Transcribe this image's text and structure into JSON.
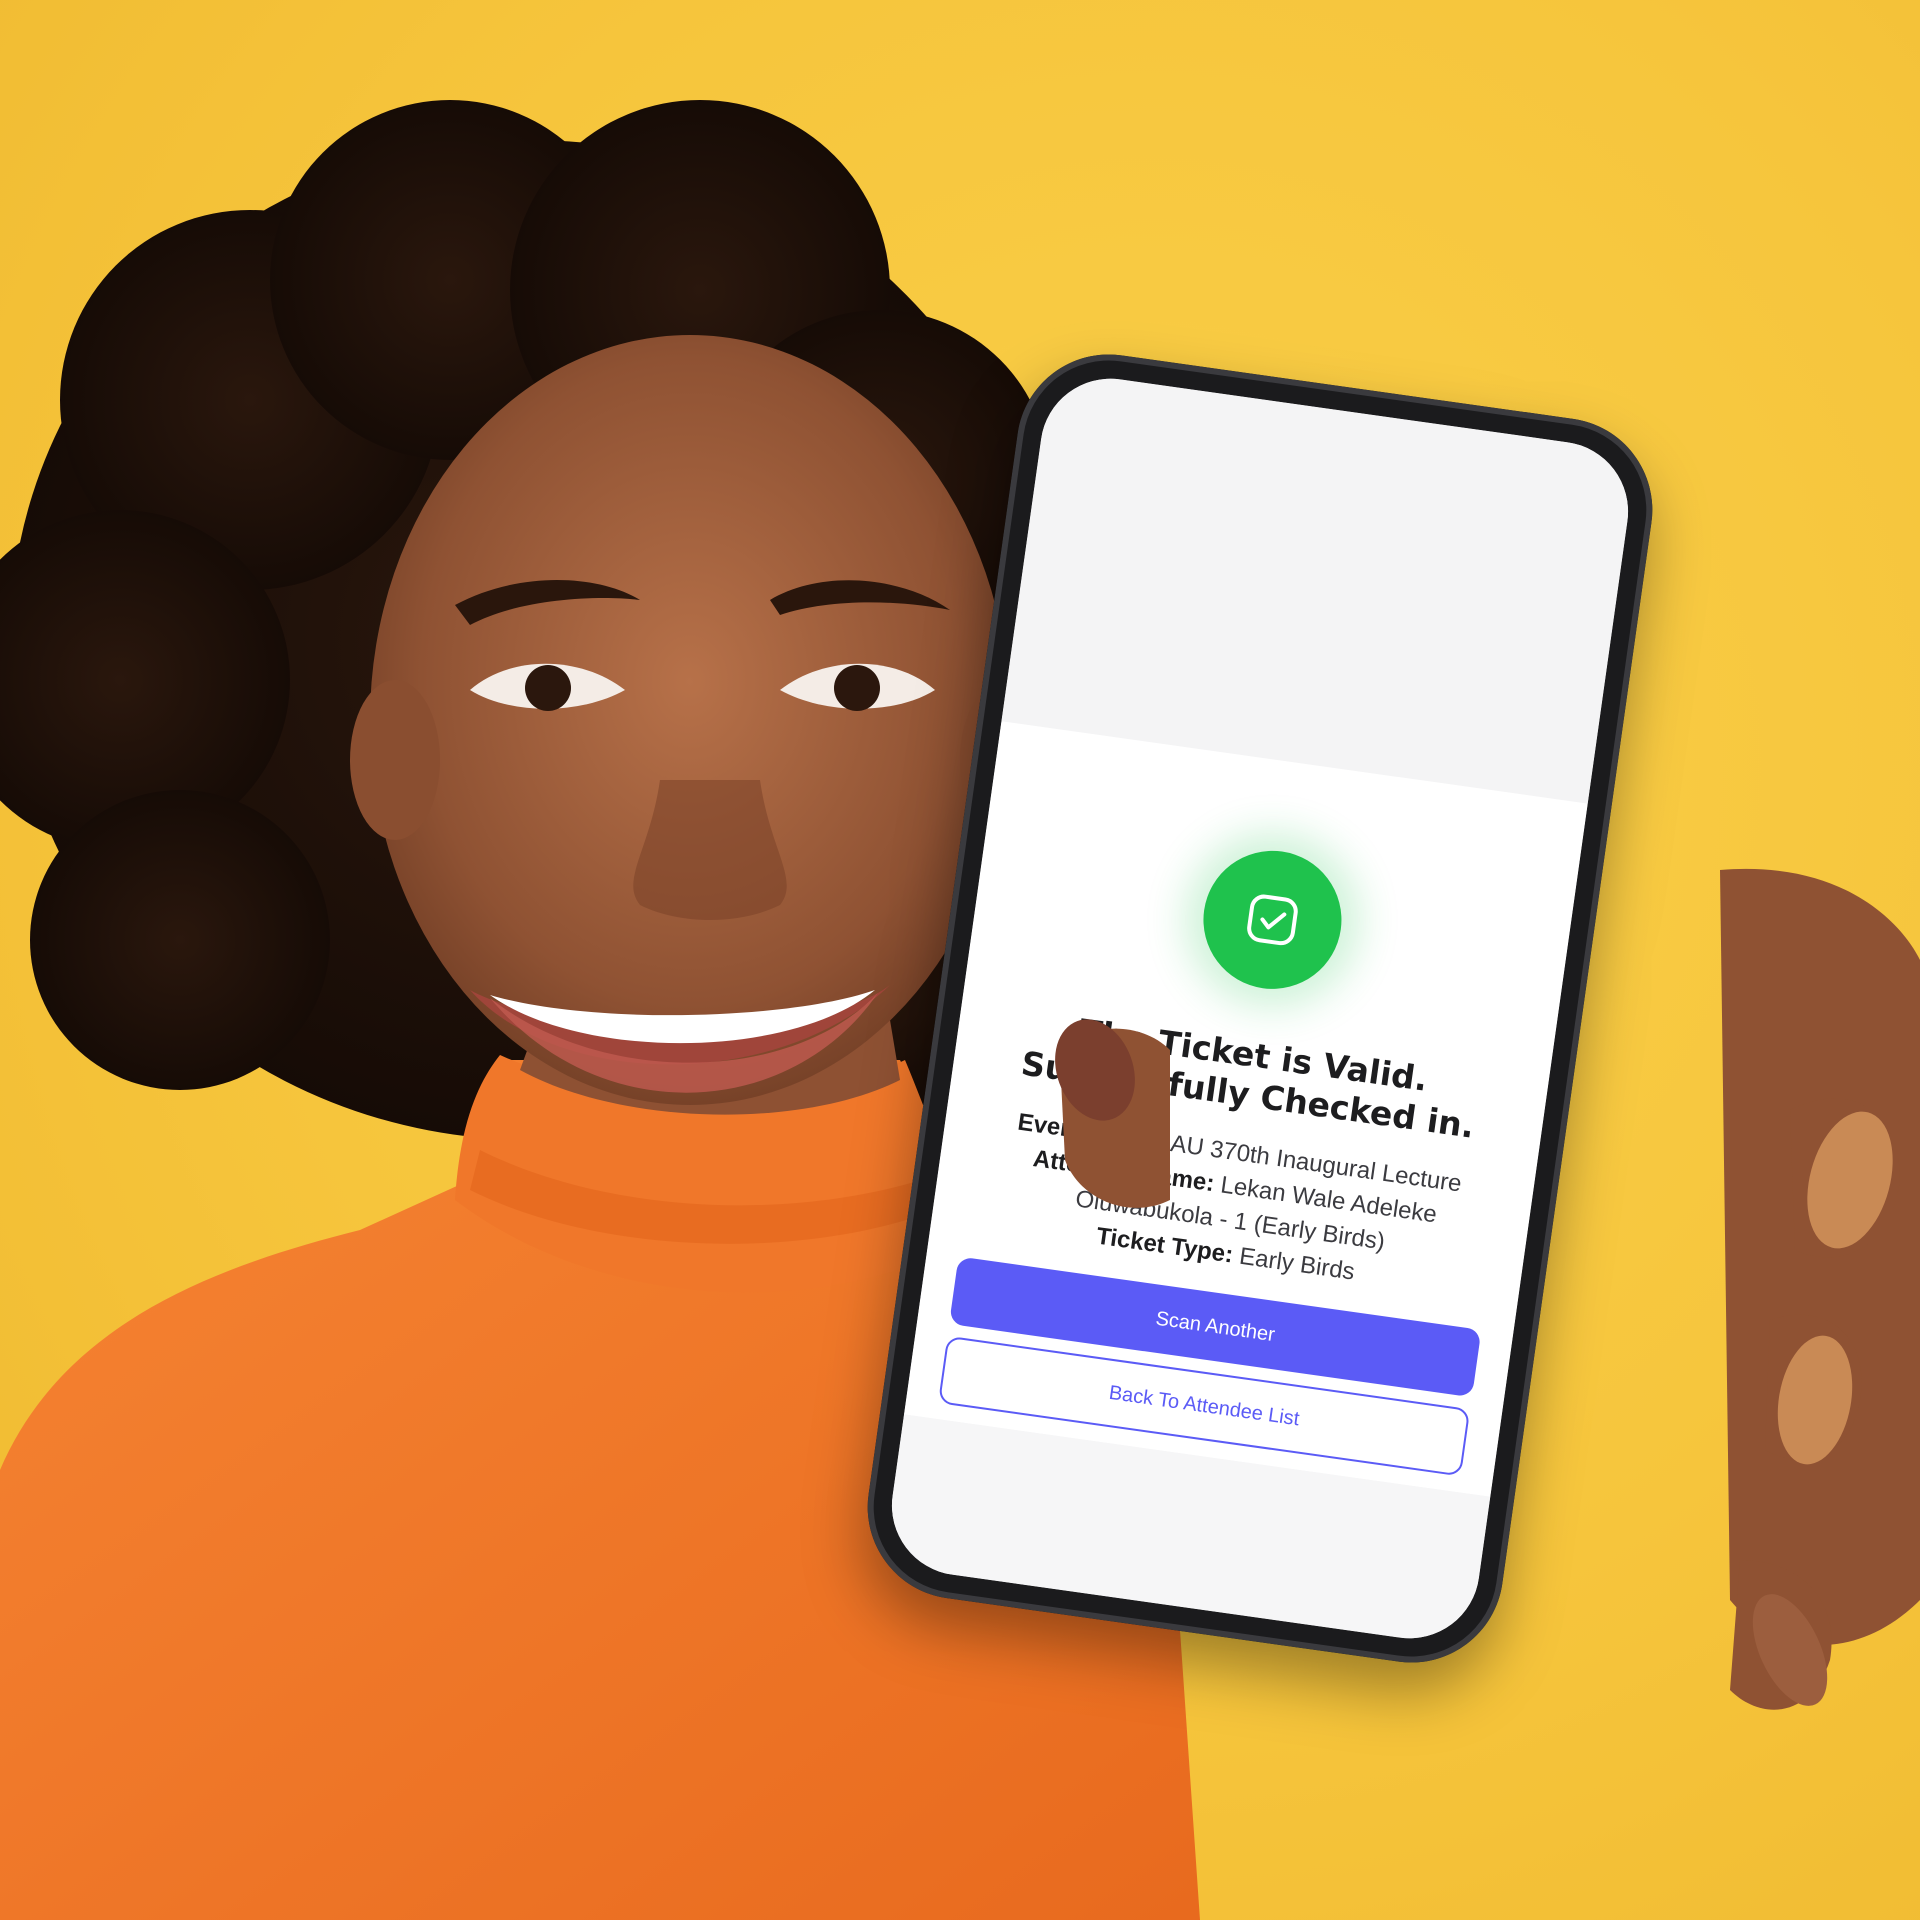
{
  "screen": {
    "status_title": "The Ticket is Valid. Successfully Checked in.",
    "event_title_label": "Event Title:",
    "event_title_value": "OAU 370th Inaugural Lecture",
    "attendee_name_label": "Attendee Name:",
    "attendee_name_value": "Lekan Wale Adeleke Oluwabukola - 1 (Early Birds)",
    "ticket_type_label": "Ticket Type:",
    "ticket_type_value": "Early Birds",
    "scan_another_label": "Scan Another",
    "back_label": "Back To Attendee List",
    "status_icon": "check-square-icon"
  },
  "colors": {
    "background": "#F6C53C",
    "success": "#1FC24D",
    "primary": "#5B5BF6",
    "shirt": "#F47A2A"
  }
}
